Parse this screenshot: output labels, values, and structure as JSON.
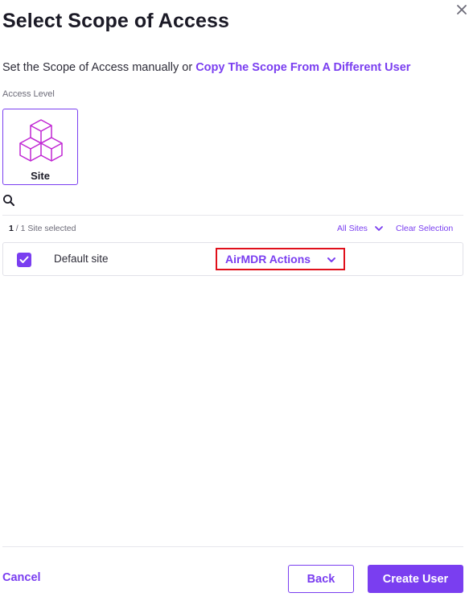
{
  "dialog": {
    "title": "Select Scope of Access",
    "close_icon": "close-icon"
  },
  "intro": {
    "text": "Set the Scope of Access manually or ",
    "copy_link": "Copy The Scope From A Different User"
  },
  "access_level": {
    "label": "Access Level",
    "selected_card": {
      "label": "Site",
      "icon": "cubes-icon"
    }
  },
  "search": {
    "icon": "search-icon"
  },
  "selection": {
    "count": "1",
    "suffix": "/ 1 Site selected",
    "filter_label": "All Sites",
    "clear_label": "Clear Selection"
  },
  "sites": [
    {
      "name": "Default site",
      "checked": true,
      "role": "AirMDR Actions"
    }
  ],
  "footer": {
    "cancel": "Cancel",
    "back": "Back",
    "create": "Create User"
  },
  "colors": {
    "accent": "#7a3ef0",
    "highlight_border": "#e0101b"
  }
}
